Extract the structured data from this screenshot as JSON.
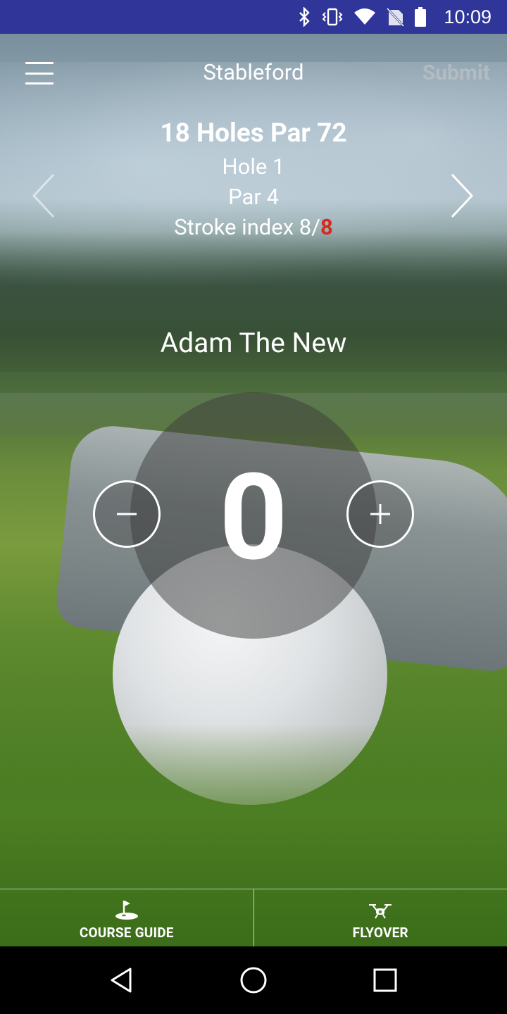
{
  "status_bar": {
    "time": "10:09",
    "icons": [
      "bluetooth-icon",
      "vibrate-icon",
      "wifi-icon",
      "no-sim-icon",
      "battery-icon"
    ],
    "background_color": "#2f3599"
  },
  "header": {
    "title": "Stableford",
    "submit_label": "Submit"
  },
  "hole_info": {
    "course": "18 Holes Par 72",
    "hole": "Hole 1",
    "par": "Par 4",
    "stroke_index_prefix": "Stroke index 8/",
    "stroke_index_highlight": "8",
    "highlight_color": "#d32c1f"
  },
  "player": {
    "name": "Adam The New",
    "score": "0"
  },
  "bottom_tabs": [
    {
      "label": "COURSE GUIDE",
      "icon": "flag-icon"
    },
    {
      "label": "FLYOVER",
      "icon": "drone-icon"
    }
  ],
  "system_nav": {
    "icons": [
      "back-icon",
      "home-icon",
      "recents-icon"
    ]
  }
}
